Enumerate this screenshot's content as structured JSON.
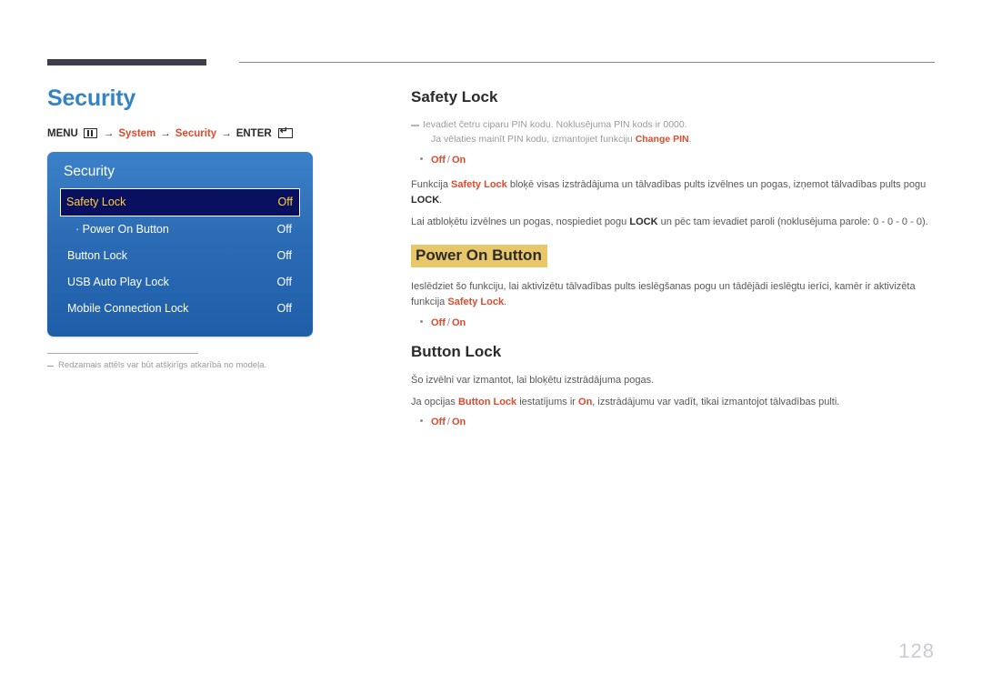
{
  "page": {
    "number": "128"
  },
  "left": {
    "title": "Security",
    "breadcrumb": {
      "menu_label": "MENU",
      "menu_icon": "menu-grid-icon",
      "arrow": "→",
      "item1": "System",
      "item2": "Security",
      "enter_label": "ENTER",
      "enter_icon": "enter-return-icon"
    },
    "osd": {
      "title": "Security",
      "rows": [
        {
          "label": "Safety Lock",
          "value": "Off",
          "selected": true,
          "sub": false
        },
        {
          "label": "·  Power On Button",
          "value": "Off",
          "selected": false,
          "sub": true
        },
        {
          "label": "Button Lock",
          "value": "Off",
          "selected": false,
          "sub": false
        },
        {
          "label": "USB Auto Play Lock",
          "value": "Off",
          "selected": false,
          "sub": false
        },
        {
          "label": "Mobile Connection Lock",
          "value": "Off",
          "selected": false,
          "sub": false
        }
      ]
    },
    "footnote": "Redzamais attēls var būt atšķirīgs atkarībā no modeļa."
  },
  "right": {
    "safety_lock": {
      "title": "Safety Lock",
      "note_line1": "Ievadiet četru ciparu PIN kodu. Noklusējuma PIN kods ir 0000.",
      "note_line2_pre": "Ja vēlaties mainīt PIN kodu, izmantojiet funkciju ",
      "note_line2_accent": "Change PIN",
      "note_line2_post": ".",
      "option_off": "Off",
      "option_sep": "/",
      "option_on": "On",
      "para1_pre": "Funkcija ",
      "para1_accent": "Safety Lock",
      "para1_mid": " bloķē visas izstrādājuma un tālvadības pults izvēlnes un pogas, izņemot tālvadības pults pogu ",
      "para1_strong": "LOCK",
      "para1_post": ".",
      "para2_pre": "Lai atbloķētu izvēlnes un pogas, nospiediet pogu ",
      "para2_strong": "LOCK",
      "para2_post": " un pēc tam ievadiet paroli (noklusējuma parole: 0 - 0 - 0 - 0)."
    },
    "power_on_button": {
      "title": "Power On Button",
      "highlight_color": "#e8c76a",
      "para_pre": "Ieslēdziet šo funkciju, lai aktivizētu tālvadības pults ieslēgšanas pogu un tādējādi ieslēgtu ierīci, kamēr ir aktivizēta funkcija ",
      "para_accent": "Safety Lock",
      "para_post": ".",
      "option_off": "Off",
      "option_sep": "/",
      "option_on": "On"
    },
    "button_lock": {
      "title": "Button Lock",
      "para1": "Šo izvēlni var izmantot, lai bloķētu izstrādājuma pogas.",
      "para2_pre": "Ja opcijas ",
      "para2_accent1": "Button Lock",
      "para2_mid": " iestatījums ir ",
      "para2_accent2": "On",
      "para2_post": ", izstrādājumu var vadīt, tikai izmantojot tālvadības pulti.",
      "option_off": "Off",
      "option_sep": "/",
      "option_on": "On"
    }
  }
}
